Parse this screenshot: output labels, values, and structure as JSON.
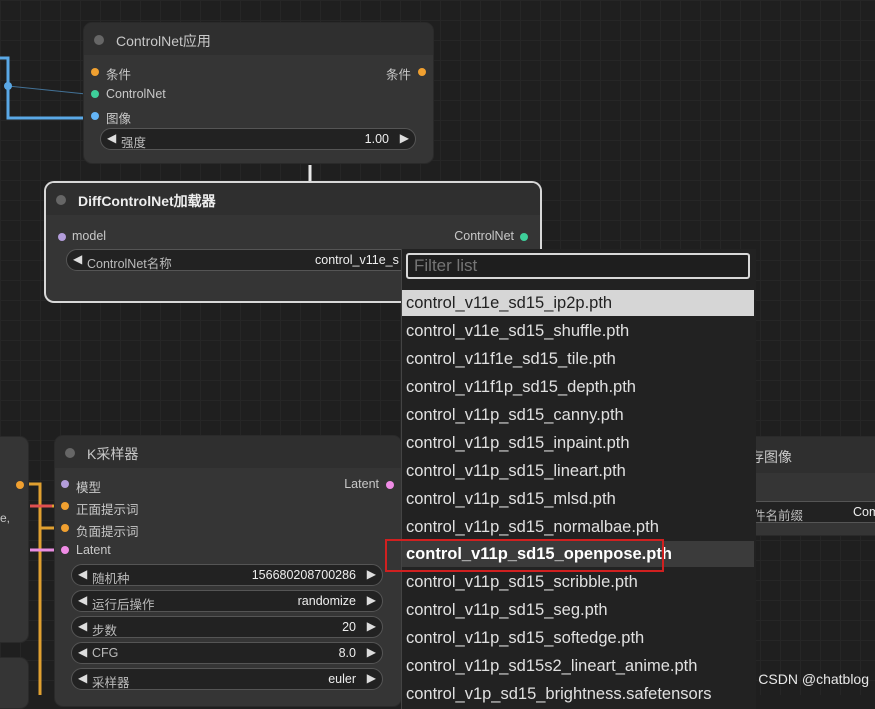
{
  "controlnet_apply": {
    "title": "ControlNet应用",
    "inputs": [
      "条件",
      "ControlNet",
      "图像"
    ],
    "output": "条件",
    "strength_label": "强度",
    "strength_value": "1.00"
  },
  "diff_loader": {
    "title": "DiffControlNet加载器",
    "input": "model",
    "output": "ControlNet",
    "name_label": "ControlNet名称",
    "name_value": "control_v11e_s"
  },
  "dropdown": {
    "placeholder": "Filter list",
    "options": [
      "control_v11e_sd15_ip2p.pth",
      "control_v11e_sd15_shuffle.pth",
      "control_v11f1e_sd15_tile.pth",
      "control_v11f1p_sd15_depth.pth",
      "control_v11p_sd15_canny.pth",
      "control_v11p_sd15_inpaint.pth",
      "control_v11p_sd15_lineart.pth",
      "control_v11p_sd15_mlsd.pth",
      "control_v11p_sd15_normalbae.pth",
      "control_v11p_sd15_openpose.pth",
      "control_v11p_sd15_scribble.pth",
      "control_v11p_sd15_seg.pth",
      "control_v11p_sd15_softedge.pth",
      "control_v11p_sd15s2_lineart_anime.pth",
      "control_v1p_sd15_brightness.safetensors"
    ],
    "highlighted_index": 0,
    "hovered_index": 9
  },
  "ksampler": {
    "title": "K采样器",
    "inputs": [
      "模型",
      "正面提示词",
      "负面提示词",
      "Latent"
    ],
    "output": "Latent",
    "widgets": [
      {
        "label": "随机种",
        "value": "156680208700286"
      },
      {
        "label": "运行后操作",
        "value": "randomize"
      },
      {
        "label": "步数",
        "value": "20"
      },
      {
        "label": "CFG",
        "value": "8.0"
      },
      {
        "label": "采样器",
        "value": "euler"
      }
    ]
  },
  "save_image": {
    "title_partial": "存图像",
    "prefix_label_partial": "件名前缀",
    "prefix_value_partial": "Com"
  },
  "left_partial_node": {
    "text_fragment": "e,"
  },
  "watermark": "CSDN @chatblog",
  "colors": {
    "condition": "#f0a030",
    "controlnet": "#3ecf9a",
    "image": "#64b5f6",
    "model": "#b39ddb",
    "latent": "#f08ce6",
    "selection_box": "#d02020"
  }
}
